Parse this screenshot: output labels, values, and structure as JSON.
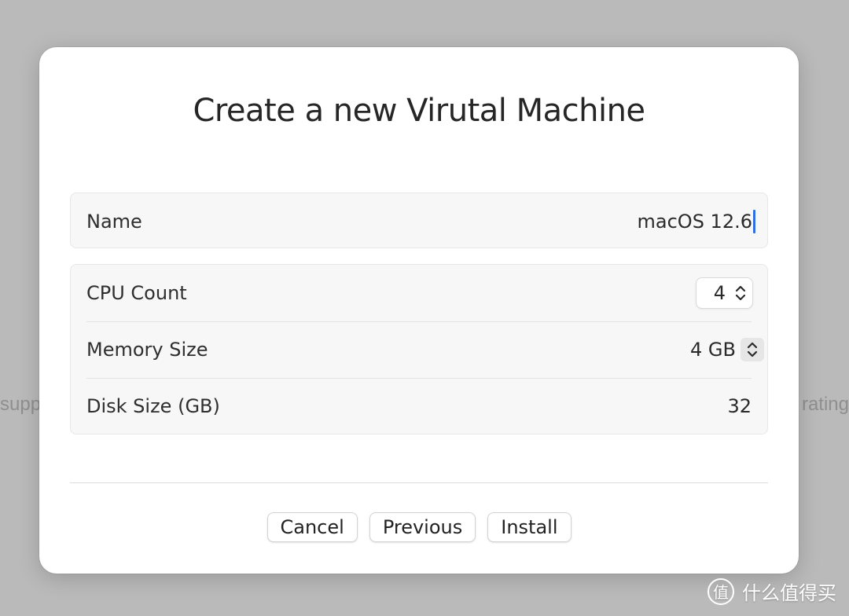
{
  "background": {
    "left_text": "supp",
    "right_text": "rating"
  },
  "dialog": {
    "title": "Create a new Virutal Machine",
    "fields": {
      "name": {
        "label": "Name",
        "value": "macOS 12.6"
      },
      "cpu_count": {
        "label": "CPU Count",
        "value": "4",
        "icon": "up-down-chevron-icon"
      },
      "memory_size": {
        "label": "Memory Size",
        "value": "4 GB",
        "icon": "up-down-chevron-icon"
      },
      "disk_size": {
        "label": "Disk Size (GB)",
        "value": "32"
      }
    },
    "buttons": {
      "cancel": "Cancel",
      "previous": "Previous",
      "install": "Install"
    }
  },
  "watermark": {
    "logo_glyph": "值",
    "text": "什么值得买"
  },
  "colors": {
    "caret": "#2f6fe0",
    "dialog_bg": "#ffffff",
    "backdrop": "#bababa"
  }
}
